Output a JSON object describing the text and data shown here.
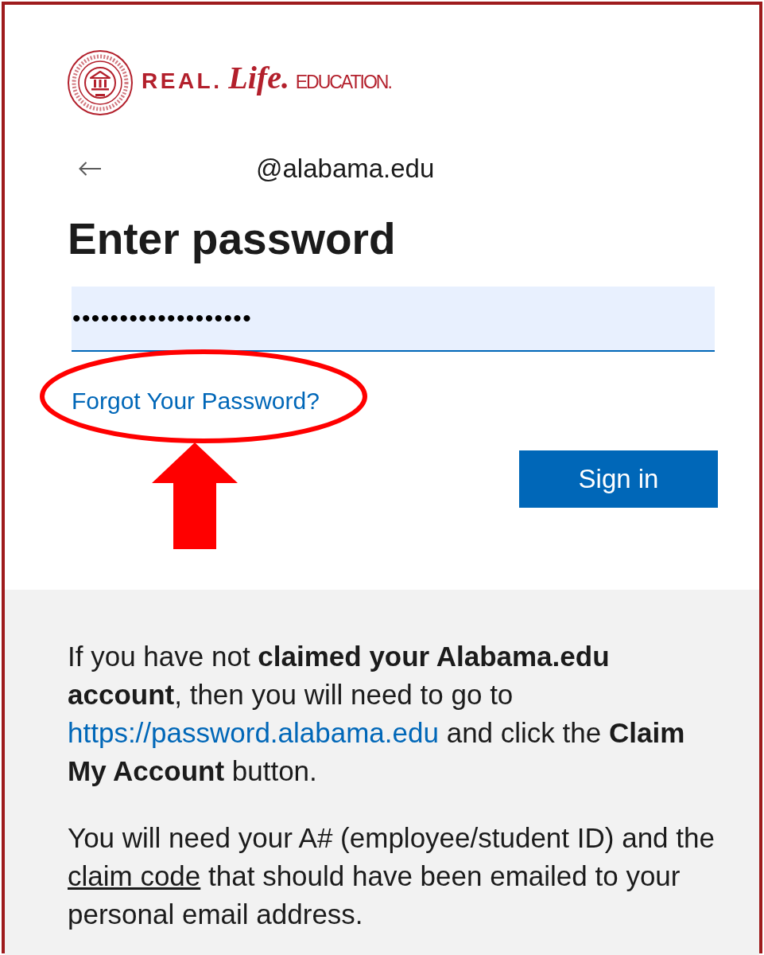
{
  "logo": {
    "wordmark": [
      {
        "text": "REAL.",
        "kind": "block"
      },
      {
        "text": "Life.",
        "kind": "script"
      },
      {
        "text": "EDUCATION.",
        "kind": "caps"
      }
    ]
  },
  "account": "@alabama.edu",
  "title": "Enter password",
  "password_field": {
    "value": "•••••••••••••••••••"
  },
  "forgot_link": {
    "label": "Forgot Your Password?",
    "highlighted": true
  },
  "buttons": [
    {
      "label": "Sign in",
      "kind": "primary"
    }
  ],
  "info": {
    "paragraphs": [
      [
        {
          "kind": "plain",
          "text": "If you have not **claimed your Alabama.edu account**, then you will need to go to"
        },
        {
          "kind": "link",
          "text": "https://password.alabama.edu"
        },
        {
          "kind": "plain",
          "text": "and click the **Claim My Account** button."
        }
      ],
      [
        {
          "kind": "plain",
          "text": "You will need your A# (employee/student ID) and the"
        },
        {
          "kind": "underline",
          "text": "claim code"
        },
        {
          "kind": "plain",
          "text": "that should have been emailed to your personal email address."
        }
      ]
    ]
  }
}
